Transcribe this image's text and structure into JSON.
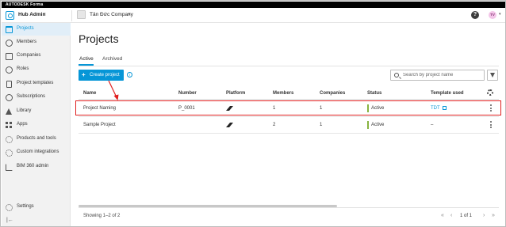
{
  "brand": {
    "text": "AUTODESK Forma"
  },
  "header": {
    "hub_name": "Hub Admin",
    "company_name": "Tân Đức Company",
    "help_icon": "question-circle-icon",
    "avatar_initials": "TV"
  },
  "sidebar": {
    "items": [
      {
        "label": "Projects",
        "icon": "folder-icon",
        "active": true
      },
      {
        "label": "Members",
        "icon": "user-icon"
      },
      {
        "label": "Companies",
        "icon": "building-icon"
      },
      {
        "label": "Roles",
        "icon": "roles-icon"
      },
      {
        "label": "Project templates",
        "icon": "template-icon"
      },
      {
        "label": "Subscriptions",
        "icon": "subscription-icon"
      },
      {
        "label": "Library",
        "icon": "library-icon"
      },
      {
        "label": "Apps",
        "icon": "apps-icon"
      },
      {
        "label": "Products and tools",
        "icon": "tools-icon"
      },
      {
        "label": "Custom integrations",
        "icon": "integration-icon"
      },
      {
        "label": "BIM 360 admin",
        "icon": "external-link-icon"
      }
    ],
    "settings_label": "Settings",
    "collapse_icon": "collapse-sidebar-icon"
  },
  "main": {
    "title": "Projects",
    "tabs": [
      {
        "label": "Active",
        "active": true
      },
      {
        "label": "Archived"
      }
    ],
    "create_button": "Create project",
    "search_placeholder": "Search by project name",
    "table": {
      "columns": [
        "Name",
        "Number",
        "Platform",
        "Members",
        "Companies",
        "Status",
        "Template used"
      ],
      "rows": [
        {
          "name": "Project Naming",
          "number": "P_0001",
          "members": "1",
          "companies": "1",
          "status": "Active",
          "template": "TDT",
          "highlighted": true
        },
        {
          "name": "Sample Project",
          "number": "",
          "members": "2",
          "companies": "1",
          "status": "Active",
          "template": "–"
        }
      ]
    },
    "footer": {
      "showing": "Showing 1–2 of 2",
      "page_current": "1",
      "page_of": "of 1"
    }
  },
  "colors": {
    "accent": "#0696d7",
    "status_active": "#87b340",
    "highlight": "#e02020"
  }
}
